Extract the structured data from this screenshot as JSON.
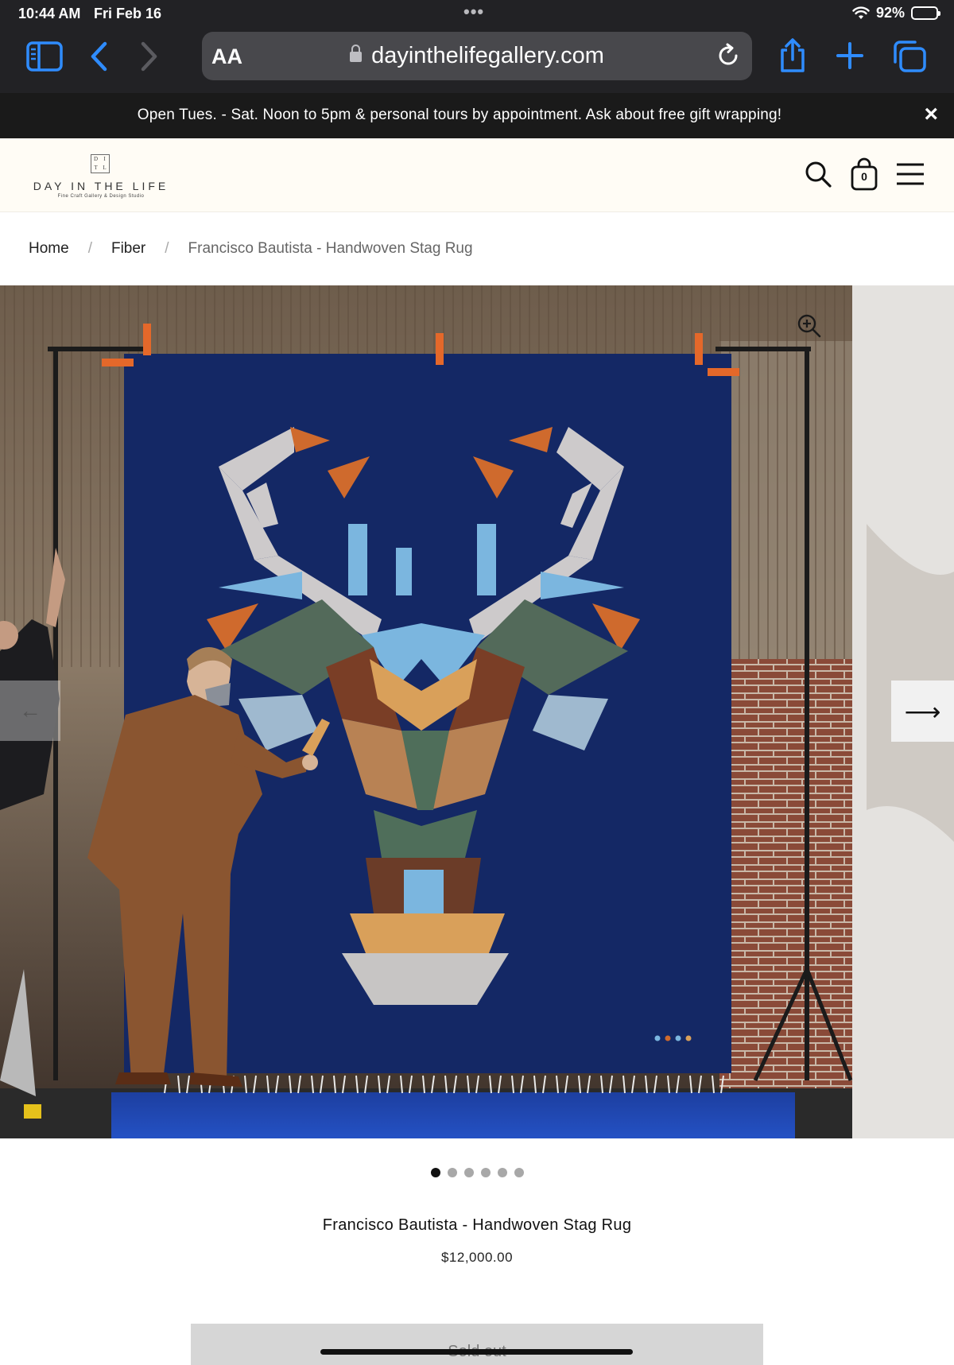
{
  "status": {
    "time": "10:44 AM",
    "date": "Fri Feb 16",
    "battery": "92%"
  },
  "browser": {
    "aa_label": "AA",
    "url": "dayinthelifegallery.com",
    "icons": [
      "sidebar-icon",
      "back-icon",
      "forward-icon",
      "lock-icon",
      "reload-icon",
      "share-icon",
      "new-tab-icon",
      "tabs-icon"
    ]
  },
  "announcement": {
    "text": "Open Tues. - Sat. Noon to 5pm & personal tours by appointment. Ask about free gift wrapping!",
    "close": "×"
  },
  "header": {
    "logo_mark": [
      "D",
      "I",
      "T",
      "L"
    ],
    "logo_name": "DAY IN THE LIFE",
    "logo_tagline": "Fine Craft Gallery & Design Studio",
    "cart_count": "0",
    "icons": [
      "search-icon",
      "cart-icon",
      "menu-icon"
    ]
  },
  "breadcrumb": {
    "home": "Home",
    "separator": "/",
    "category": "Fiber",
    "current": "Francisco Bautista - Handwoven Stag Rug"
  },
  "gallery": {
    "prev_arrow": "←",
    "next_arrow": "⟶",
    "slide_count": 6,
    "active_slide": 1
  },
  "product": {
    "title": "Francisco Bautista - Handwoven Stag Rug",
    "price": "$12,000.00",
    "button_label": "Sold out"
  }
}
